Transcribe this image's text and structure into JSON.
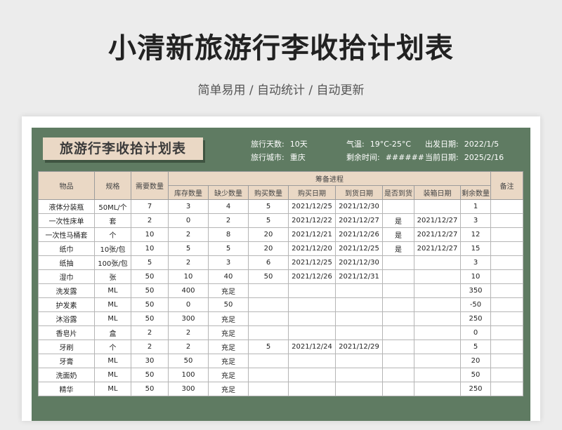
{
  "header": {
    "title": "小清新旅游行李收拾计划表",
    "subtitle": "简单易用  /  自动统计  /  自动更新"
  },
  "sheet": {
    "badge": "旅游行李收拾计划表",
    "info": [
      {
        "label": "旅行天数:",
        "value": "10天"
      },
      {
        "label": "旅行城市:",
        "value": "重庆"
      },
      {
        "label": "气温:",
        "value": "19°C-25°C"
      },
      {
        "label": "剩余时间:",
        "value": "######"
      },
      {
        "label": "出发日期:",
        "value": "2022/1/5"
      },
      {
        "label": "当前日期:",
        "value": "2025/2/16"
      }
    ],
    "columns": {
      "item": "物品",
      "spec": "规格",
      "need": "需要数量",
      "progress_group": "筹备进程",
      "stock": "库存数量",
      "short": "缺少数量",
      "buy_qty": "购买数量",
      "buy_date": "购买日期",
      "arrive_date": "到货日期",
      "arrived": "是否到货",
      "pack_date": "装箱日期",
      "remain": "剩余数量",
      "note": "备注"
    },
    "rows": [
      [
        "液体分装瓶",
        "50ML/个",
        "7",
        "3",
        "4",
        "5",
        "2021/12/25",
        "2021/12/30",
        "",
        "",
        "1",
        ""
      ],
      [
        "一次性床单",
        "套",
        "2",
        "0",
        "2",
        "5",
        "2021/12/22",
        "2021/12/27",
        "是",
        "2021/12/27",
        "3",
        ""
      ],
      [
        "一次性马桶套",
        "个",
        "10",
        "2",
        "8",
        "20",
        "2021/12/21",
        "2021/12/26",
        "是",
        "2021/12/27",
        "12",
        ""
      ],
      [
        "纸巾",
        "10张/包",
        "10",
        "5",
        "5",
        "20",
        "2021/12/20",
        "2021/12/25",
        "是",
        "2021/12/27",
        "15",
        ""
      ],
      [
        "纸抽",
        "100张/包",
        "5",
        "2",
        "3",
        "6",
        "2021/12/25",
        "2021/12/30",
        "",
        "",
        "3",
        ""
      ],
      [
        "湿巾",
        "张",
        "50",
        "10",
        "40",
        "50",
        "2021/12/26",
        "2021/12/31",
        "",
        "",
        "10",
        ""
      ],
      [
        "洗发露",
        "ML",
        "50",
        "400",
        "充足",
        "",
        "",
        "",
        "",
        "",
        "350",
        ""
      ],
      [
        "护发素",
        "ML",
        "50",
        "0",
        "50",
        "",
        "",
        "",
        "",
        "",
        "-50",
        ""
      ],
      [
        "沐浴露",
        "ML",
        "50",
        "300",
        "充足",
        "",
        "",
        "",
        "",
        "",
        "250",
        ""
      ],
      [
        "香皂片",
        "盒",
        "2",
        "2",
        "充足",
        "",
        "",
        "",
        "",
        "",
        "0",
        ""
      ],
      [
        "牙刷",
        "个",
        "2",
        "2",
        "充足",
        "5",
        "2021/12/24",
        "2021/12/29",
        "",
        "",
        "5",
        ""
      ],
      [
        "牙膏",
        "ML",
        "30",
        "50",
        "充足",
        "",
        "",
        "",
        "",
        "",
        "20",
        ""
      ],
      [
        "洗面奶",
        "ML",
        "50",
        "100",
        "充足",
        "",
        "",
        "",
        "",
        "",
        "50",
        ""
      ],
      [
        "精华",
        "ML",
        "50",
        "300",
        "充足",
        "",
        "",
        "",
        "",
        "",
        "250",
        ""
      ]
    ]
  }
}
